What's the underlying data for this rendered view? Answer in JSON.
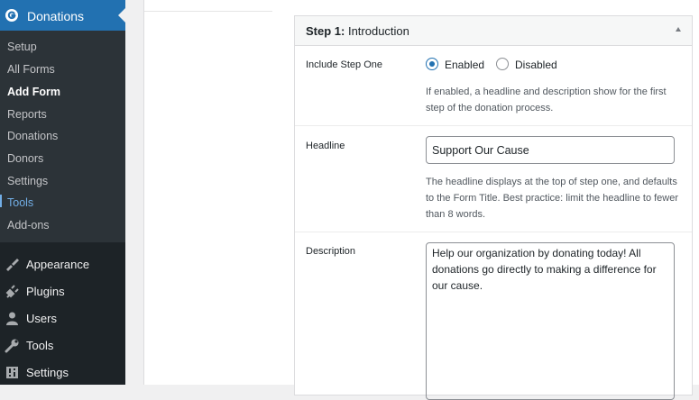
{
  "sidebar": {
    "active_menu": "Donations",
    "submenu": [
      "Setup",
      "All Forms",
      "Add Form",
      "Reports",
      "Donations",
      "Donors",
      "Settings",
      "Tools",
      "Add-ons"
    ],
    "menu": [
      {
        "label": "Appearance",
        "icon": "paintbrush-icon"
      },
      {
        "label": "Plugins",
        "icon": "plugin-icon"
      },
      {
        "label": "Users",
        "icon": "users-icon"
      },
      {
        "label": "Tools",
        "icon": "wrench-icon"
      },
      {
        "label": "Settings",
        "icon": "settings-icon"
      }
    ]
  },
  "metabox": {
    "title_strong": "Step 1:",
    "title_rest": " Introduction"
  },
  "fields": {
    "include_step_one": {
      "label": "Include Step One",
      "option_enabled": "Enabled",
      "option_disabled": "Disabled",
      "selected": "Enabled",
      "help": "If enabled, a headline and description show for the first step of the donation process."
    },
    "headline": {
      "label": "Headline",
      "value": "Support Our Cause",
      "help": "The headline displays at the top of step one, and defaults to the Form Title. Best practice: limit the headline to fewer than 8 words."
    },
    "description": {
      "label": "Description",
      "value": "Help our organization by donating today! All donations go directly to making a difference for our cause."
    }
  },
  "colors": {
    "sidebar_bg": "#1d2327",
    "submenu_bg": "#2c3338",
    "accent": "#2271b1",
    "link": "#72aee6"
  }
}
